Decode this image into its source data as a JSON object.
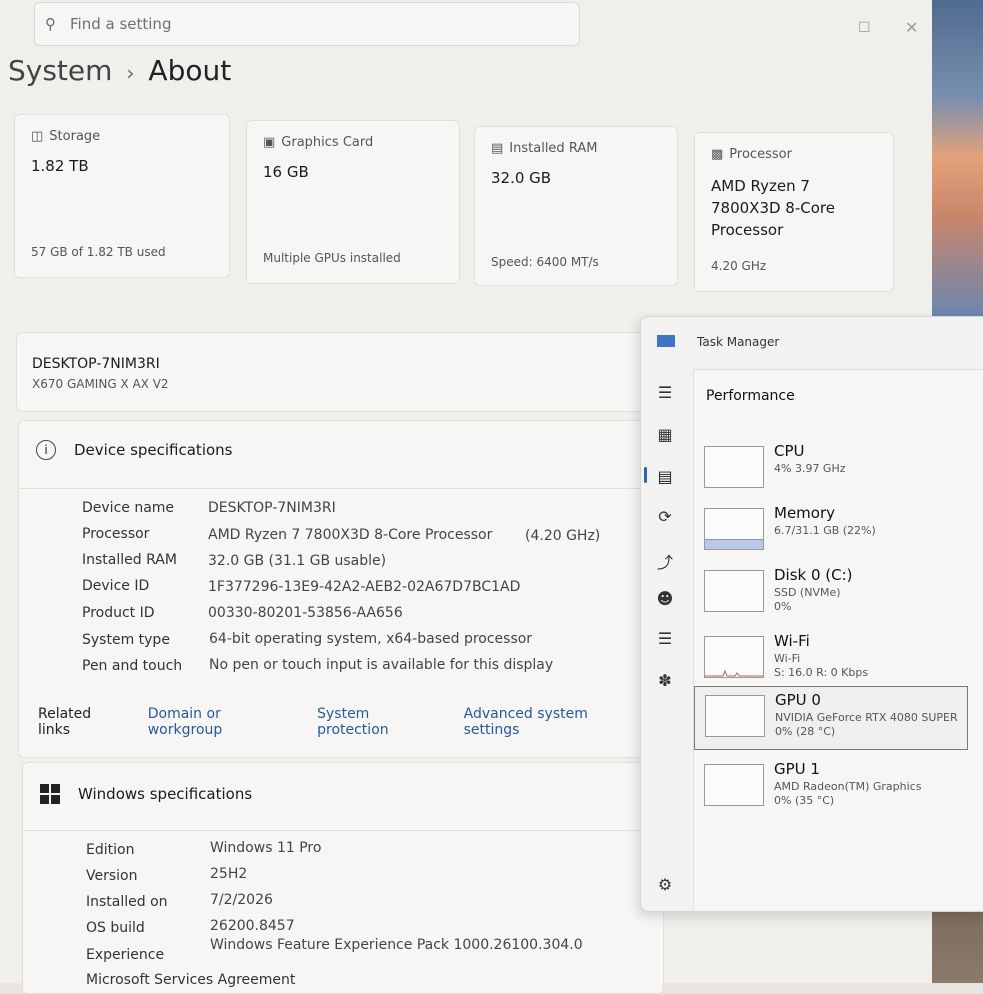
{
  "search": {
    "placeholder": "Find a setting"
  },
  "breadcrumb": {
    "parent": "System",
    "separator": "›",
    "current": "About"
  },
  "cards": {
    "storage": {
      "label": "Storage",
      "value": "1.82 TB",
      "sub": "57 GB of 1.82 TB used"
    },
    "graphics": {
      "label": "Graphics Card",
      "value": "16 GB",
      "sub": "Multiple GPUs installed"
    },
    "ram": {
      "label": "Installed RAM",
      "value": "32.0 GB",
      "sub": "Speed: 6400 MT/s"
    },
    "processor": {
      "label": "Processor",
      "value": "AMD Ryzen 7 7800X3D 8-Core Processor",
      "sub": "4.20 GHz"
    }
  },
  "device": {
    "name": "DESKTOP-7NIM3RI",
    "board": "X670 GAMING X AX V2"
  },
  "device_specs": {
    "title": "Device specifications",
    "rows": [
      {
        "k": "Device name",
        "v": "DESKTOP-7NIM3RI"
      },
      {
        "k": "Processor",
        "v": "AMD Ryzen 7 7800X3D 8-Core Processor",
        "extra": "(4.20 GHz)"
      },
      {
        "k": "Installed RAM",
        "v": "32.0 GB (31.1 GB usable)"
      },
      {
        "k": "Device ID",
        "v": "1F377296-13E9-42A2-AEB2-02A67D7BC1AD"
      },
      {
        "k": "Product ID",
        "v": "00330-80201-53856-AA656"
      },
      {
        "k": "System type",
        "v": "64-bit operating system, x64-based processor"
      },
      {
        "k": "Pen and touch",
        "v": "No pen or touch input is available for this display"
      }
    ]
  },
  "related": {
    "label": "Related links",
    "links": [
      "Domain or workgroup",
      "System protection",
      "Advanced system settings"
    ]
  },
  "windows_specs": {
    "title": "Windows specifications",
    "rows": [
      {
        "k": "Edition",
        "v": "Windows 11 Pro"
      },
      {
        "k": "Version",
        "v": "25H2"
      },
      {
        "k": "Installed on",
        "v": "7/2/2026"
      },
      {
        "k": "OS build",
        "v": "26200.8457"
      },
      {
        "k": "Experience",
        "v": "Windows Feature Experience Pack 1000.26100.304.0"
      },
      {
        "k": "Microsoft Services Agreement",
        "v": ""
      }
    ]
  },
  "task_manager": {
    "title": "Task Manager",
    "section": "Performance",
    "items": [
      {
        "name": "CPU",
        "l2": "4% 3.97 GHz",
        "l3": ""
      },
      {
        "name": "Memory",
        "l2": "6.7/31.1 GB (22%)",
        "l3": ""
      },
      {
        "name": "Disk 0 (C:)",
        "l2": "SSD (NVMe)",
        "l3": "0%"
      },
      {
        "name": "Wi-Fi",
        "l2": "Wi-Fi",
        "l3": "S: 16.0 R: 0 Kbps"
      },
      {
        "name": "GPU 0",
        "l2": "NVIDIA GeForce RTX 4080 SUPER",
        "l3": "0% (28 °C)"
      },
      {
        "name": "GPU 1",
        "l2": "AMD Radeon(TM) Graphics",
        "l3": "0% (35 °C)"
      }
    ],
    "memory_usage_fraction": 0.22
  },
  "colors": {
    "accent": "#245a9a",
    "tm_logo": "#3c74c6"
  }
}
